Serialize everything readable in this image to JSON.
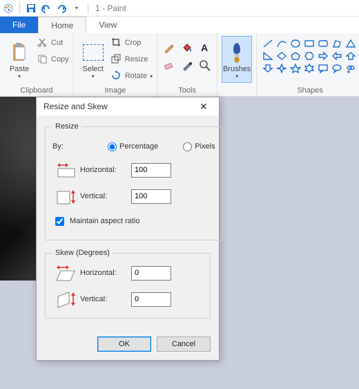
{
  "title": "1 - Paint",
  "qat": {
    "app_icon": "paint-logo",
    "save_icon": "save-icon",
    "undo_icon": "undo-icon",
    "redo_icon": "redo-icon",
    "customize_icon": "chevron-down-icon"
  },
  "tabs": {
    "file": "File",
    "home": "Home",
    "view": "View"
  },
  "ribbon": {
    "clipboard": {
      "paste": "Paste",
      "cut": "Cut",
      "copy": "Copy",
      "group_label": "Clipboard"
    },
    "image": {
      "select": "Select",
      "crop": "Crop",
      "resize": "Resize",
      "rotate": "Rotate",
      "group_label": "Image"
    },
    "tools": {
      "group_label": "Tools",
      "items": [
        "pencil-icon",
        "fill-icon",
        "text-icon",
        "eraser-icon",
        "picker-icon",
        "magnifier-icon"
      ]
    },
    "brushes": {
      "label": "Brushes"
    },
    "shapes": {
      "group_label": "Shapes"
    }
  },
  "dialog": {
    "title": "Resize and Skew",
    "resize": {
      "legend": "Resize",
      "by_label": "By:",
      "percentage": "Percentage",
      "pixels": "Pixels",
      "horizontal_label": "Horizontal:",
      "horizontal_value": "100",
      "vertical_label": "Vertical:",
      "vertical_value": "100",
      "aspect_label": "Maintain aspect ratio",
      "aspect_checked": true,
      "mode": "percentage"
    },
    "skew": {
      "legend": "Skew (Degrees)",
      "horizontal_label": "Horizontal:",
      "horizontal_value": "0",
      "vertical_label": "Vertical:",
      "vertical_value": "0"
    },
    "buttons": {
      "ok": "OK",
      "cancel": "Cancel"
    }
  }
}
